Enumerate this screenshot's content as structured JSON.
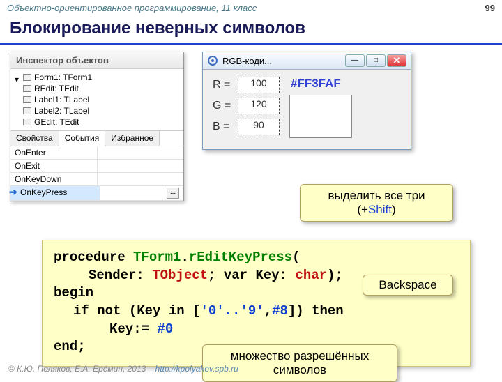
{
  "header": {
    "topic": "Объектно-ориентированное программирование, 11 класс",
    "page": "99"
  },
  "title": "Блокирование неверных символов",
  "inspector": {
    "caption": "Инспектор объектов",
    "tree": {
      "root": "Form1: TForm1",
      "items": [
        "REdit: TEdit",
        "Label1: TLabel",
        "Label2: TLabel",
        "GEdit: TEdit"
      ]
    },
    "tabs": [
      "Свойства",
      "События",
      "Избранное"
    ],
    "events": [
      "OnEnter",
      "OnExit",
      "OnKeyDown",
      "OnKeyPress"
    ],
    "selected_event": "OnKeyPress",
    "ellipsis": "..."
  },
  "rgb": {
    "title": "RGB-коди...",
    "rows": [
      {
        "label": "R =",
        "value": "100"
      },
      {
        "label": "G =",
        "value": "120"
      },
      {
        "label": "B =",
        "value": "90"
      }
    ],
    "hex": "#FF3FAF"
  },
  "callouts": {
    "select_all_1": "выделить все три",
    "select_all_2a": "(+",
    "select_all_2b": "Shift",
    "select_all_2c": ")",
    "backspace": "Backspace",
    "allowed": "множество разрешённых символов"
  },
  "code": {
    "l1a": "procedure ",
    "l1b": "TForm1",
    "l1c": ".",
    "l1d": "rEditKeyPress",
    "l1e": "(",
    "l2a": "Sender: ",
    "l2b": "TObject",
    "l2c": "; var Key: ",
    "l2d": "char",
    "l2e": ");",
    "l3": "begin",
    "l4a": "if not (Key ",
    "l4b": "in",
    "l4c": " [",
    "l4d": "'0'..'9'",
    "l4e": ",",
    "l4f": "#8",
    "l4g": "]) then",
    "l5a": "Key:= ",
    "l5b": "#0",
    "l6": "end;"
  },
  "footer": {
    "copyright": "© К.Ю. Поляков, Е.А. Ерёмин, 2013",
    "url": "http://kpolyakov.spb.ru"
  }
}
